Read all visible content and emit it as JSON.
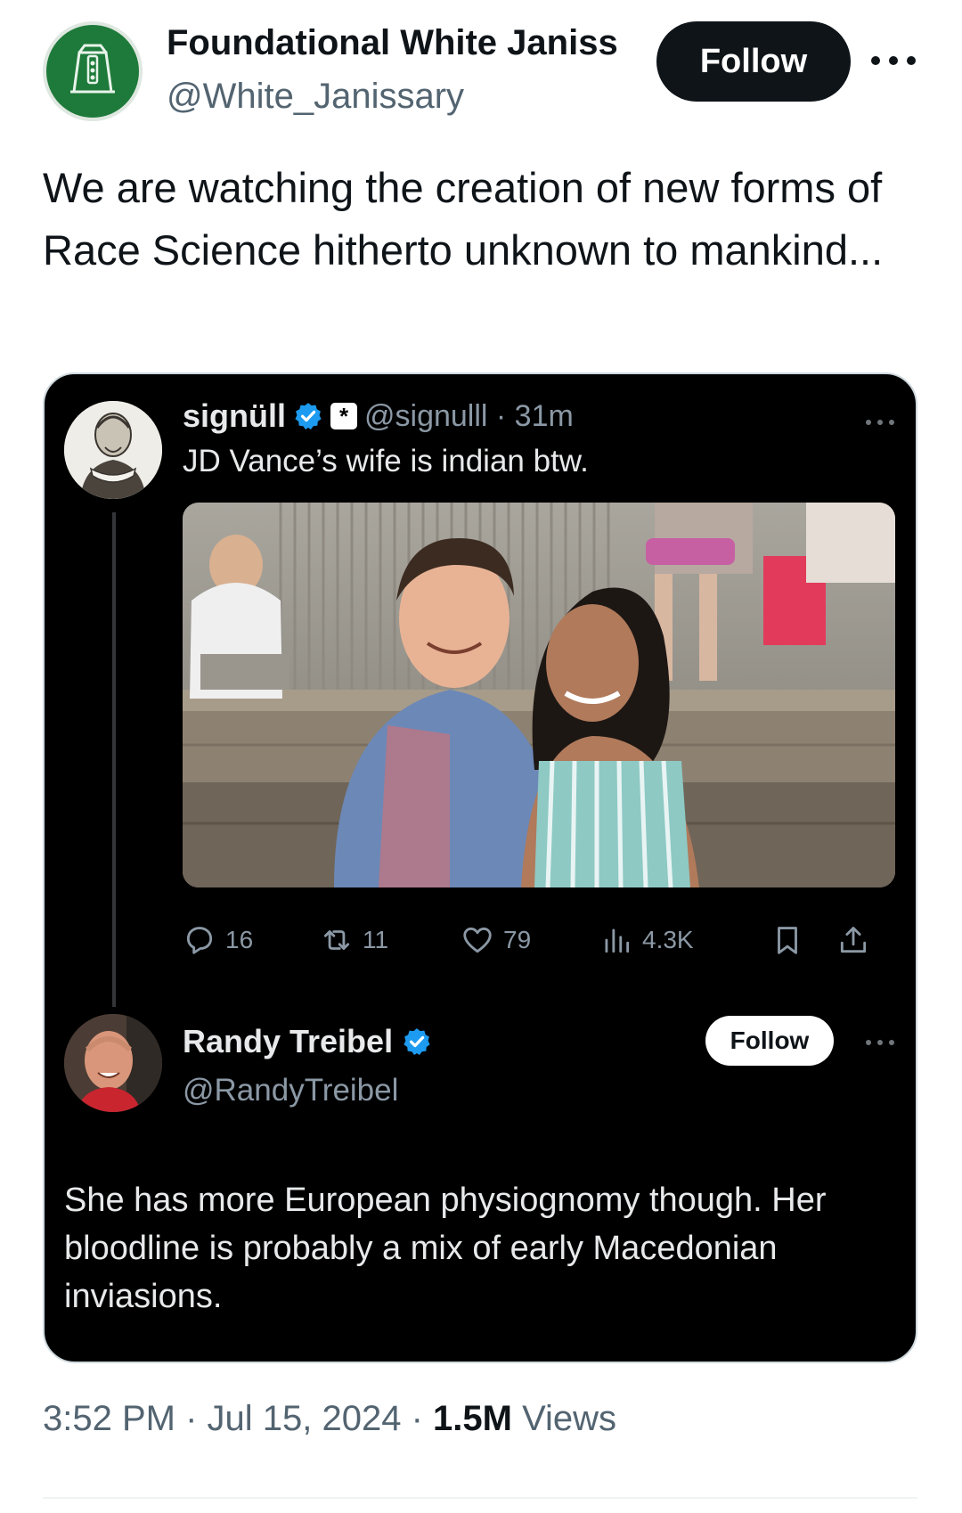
{
  "post": {
    "author": {
      "name": "Foundational White Janiss",
      "handle": "@White_Janissary"
    },
    "follow_label": "Follow",
    "text": "We are watching the creation of new forms of Race Science hitherto unknown to mankind...",
    "timestamp": "3:52 PM · Jul 15, 2024 · ",
    "views_count": "1.5M",
    "views_label": " Views"
  },
  "screenshot": {
    "quoted": {
      "name": "signüll",
      "affiliate_badge": "*",
      "handle_time": "@signulll · 31m",
      "text": "JD Vance’s wife is indian btw.",
      "actions": {
        "replies": "16",
        "reposts": "11",
        "likes": "79",
        "views": "4.3K"
      }
    },
    "reply": {
      "name": "Randy Treibel",
      "handle": "@RandyTreibel",
      "follow_label": "Follow",
      "text": "She has more European physiognomy though. Her bloodline is probably a mix of early Macedonian inviasions."
    }
  },
  "colors": {
    "brand_avatar": "#1e7a3a",
    "verified_blue": "#1d9bf0",
    "dark_bg": "#000000"
  },
  "icons": [
    "more-icon",
    "verified-icon",
    "reply-icon",
    "repost-icon",
    "like-icon",
    "views-icon",
    "bookmark-icon",
    "share-icon"
  ]
}
